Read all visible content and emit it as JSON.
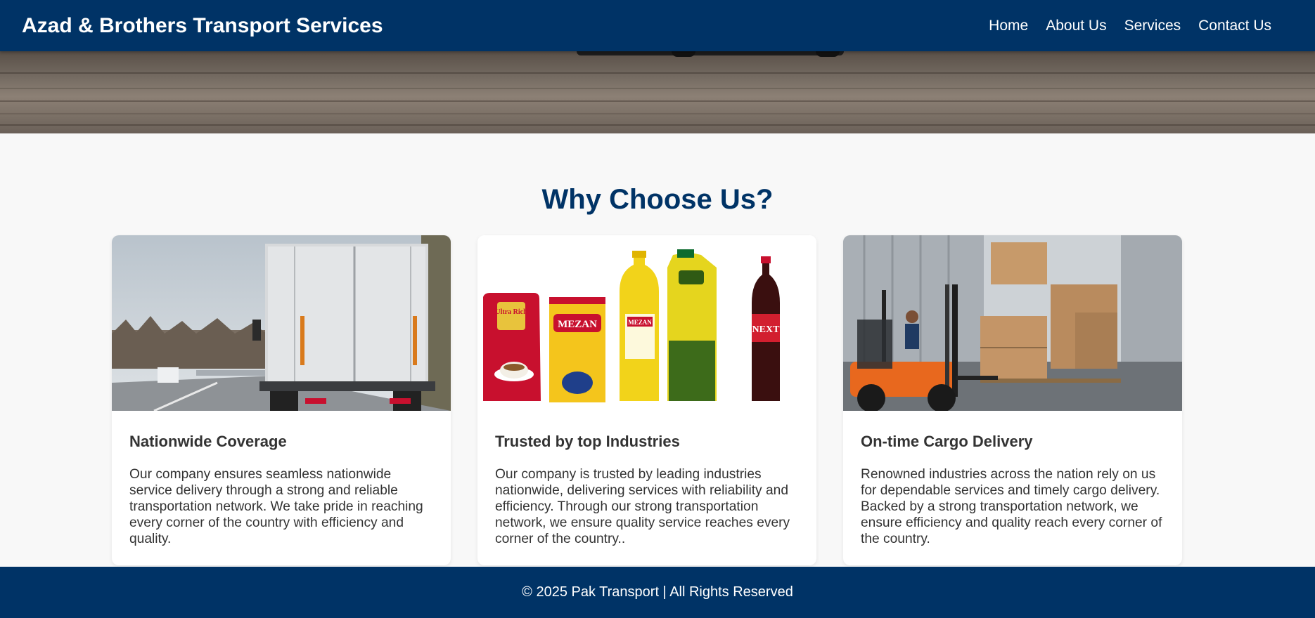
{
  "header": {
    "brand": "Azad & Brothers Transport Services",
    "nav": [
      "Home",
      "About Us",
      "Services",
      "Contact Us"
    ]
  },
  "section": {
    "title": "Why Choose Us?"
  },
  "cards": [
    {
      "title": "Nationwide Coverage",
      "text": "Our company ensures seamless nationwide service delivery through a strong and reliable transportation network. We take pride in reaching every corner of the country with efficiency and quality.",
      "image": "truck-on-highway"
    },
    {
      "title": "Trusted by top Industries",
      "text": "Our company is trusted by leading industries nationwide, delivering services with reliability and efficiency. Through our strong transportation network, we ensure quality service reaches every corner of the country..",
      "image": "consumer-products",
      "product_labels": [
        "Ultra Rich",
        "MEZAN",
        "MEZAN",
        "NEXT"
      ]
    },
    {
      "title": "On-time Cargo Delivery",
      "text": "Renowned industries across the nation rely on us for dependable services and timely cargo delivery. Backed by a strong transportation network, we ensure efficiency and quality reach every corner of the country.",
      "image": "forklift-loading"
    }
  ],
  "footer": {
    "text": "© 2025 Pak Transport | All Rights Reserved"
  },
  "colors": {
    "primary": "#003366",
    "background": "#f8f8f8",
    "card": "#ffffff",
    "text": "#333333"
  }
}
